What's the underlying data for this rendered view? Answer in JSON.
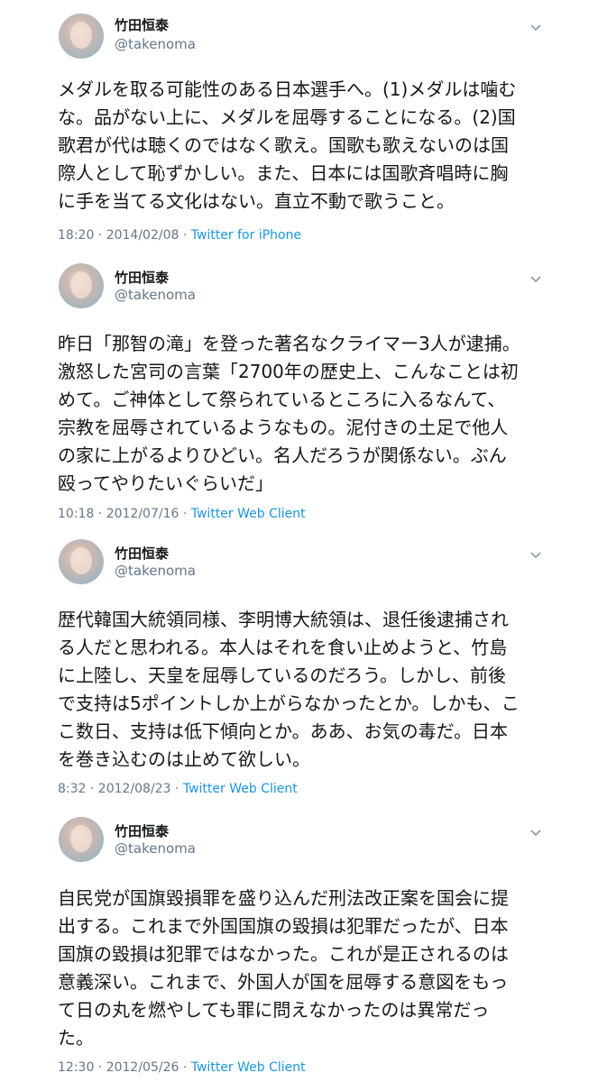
{
  "tweets": [
    {
      "name": "竹田恒泰",
      "handle": "@takenoma",
      "lines": [
        "メダルを取る可能性のある日本選手へ。(1)メダルは噛む",
        "な。品がない上に、メダルを屈辱することになる。(2)国",
        "歌君が代は聴くのではなく歌え。国歌も歌えないのは国",
        "際人として恥ずかしい。また、日本には国歌斉唱時に胸",
        "に手を当てる文化はない。直立不動で歌うこと。"
      ],
      "time": "18:20 · 2014/02/08 · ",
      "source": "Twitter for iPhone"
    },
    {
      "name": "竹田恒泰",
      "handle": "@takenoma",
      "lines": [
        "昨日「那智の滝」を登った著名なクライマー3人が逮捕。",
        "激怒した宮司の言葉「2700年の歴史上、こんなことは初",
        "めて。ご神体として祭られているところに入るなんて、",
        "宗教を屈辱されているようなもの。泥付きの土足で他人",
        "の家に上がるよりひどい。名人だろうが関係ない。ぶん",
        "殴ってやりたいぐらいだ」"
      ],
      "time": "10:18 · 2012/07/16 · ",
      "source": "Twitter Web Client"
    },
    {
      "name": "竹田恒泰",
      "handle": "@takenoma",
      "lines": [
        "歴代韓国大統領同様、李明博大統領は、退任後逮捕され",
        "る人だと思われる。本人はそれを食い止めようと、竹島",
        "に上陸し、天皇を屈辱しているのだろう。しかし、前後",
        "で支持は5ポイントしか上がらなかったとか。しかも、こ",
        "こ数日、支持は低下傾向とか。ああ、お気の毒だ。日本",
        "を巻き込むのは止めて欲しい。"
      ],
      "time": "8:32 · 2012/08/23 · ",
      "source": "Twitter Web Client"
    },
    {
      "name": "竹田恒泰",
      "handle": "@takenoma",
      "lines": [
        "自民党が国旗毀損罪を盛り込んだ刑法改正案を国会に提",
        "出する。これまで外国国旗の毀損は犯罪だったが、日本",
        "国旗の毀損は犯罪ではなかった。これが是正されるのは",
        "意義深い。これまで、外国人が国を屈辱する意図をもっ",
        "て日の丸を燃やしても罪に問えなかったのは異常だっ",
        "た。"
      ],
      "time": "12:30 · 2012/05/26 · ",
      "source": "Twitter Web Client"
    }
  ],
  "colors": {
    "text": "#14171a",
    "muted": "#657786",
    "link": "#1b95e0"
  },
  "icons": {
    "menu": "chevron-down-icon"
  }
}
